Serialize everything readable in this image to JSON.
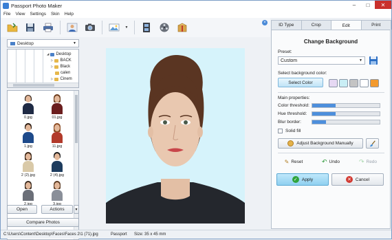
{
  "window": {
    "title": "Passport Photo Maker"
  },
  "menu": [
    "File",
    "View",
    "Settings",
    "Skin",
    "Help"
  ],
  "toolbar": {
    "icons": [
      "open-folder-icon",
      "save-icon",
      "print-icon",
      "user-template-icon",
      "camera-icon",
      "image-enhance-icon",
      "film-icon",
      "film-reel-icon",
      "package-icon"
    ]
  },
  "left": {
    "folder": "Desktop",
    "tree": [
      "Desktop",
      "BACK",
      "Black",
      "calen",
      "Cinem"
    ],
    "thumbnails": [
      "0.jpg",
      "01.jpg",
      "1.jpg",
      "11.jpg",
      "2 (2).jpg",
      "2 (4).jpg",
      "2.jpg",
      "3.jpg"
    ],
    "open_label": "Open",
    "actions_label": "Actions",
    "compare_label": "Compare Photos"
  },
  "tabs": [
    "ID Type",
    "Crop",
    "Edit",
    "Print"
  ],
  "active_tab": "Edit",
  "edit": {
    "title": "Change Background",
    "preset_label": "Preset:",
    "preset_value": "Custom",
    "bgcolor_label": "Select background color:",
    "select_color_label": "Select Color",
    "swatches": [
      "#e6d8f3",
      "#c9eef5",
      "#c4c4c4",
      "#ffffff",
      "#f39a2e"
    ],
    "main_props_label": "Main properties:",
    "properties": [
      {
        "label": "Color threshold:",
        "value": 0.35
      },
      {
        "label": "Hue threshold:",
        "value": 0.35
      },
      {
        "label": "Blur border:",
        "value": 0.2
      }
    ],
    "solid_fill_label": "Solid fill",
    "adjust_label": "Adjust Background Manually",
    "reset_label": "Reset",
    "undo_label": "Undo",
    "redo_label": "Redo",
    "apply_label": "Apply",
    "cancel_label": "Cancel"
  },
  "status": {
    "path": "C:\\Users\\Content\\Desktop\\Faces\\Faces 2\\1 (71).jpg",
    "type": "Passport",
    "size": "Size: 35 x 45 mm"
  },
  "colors": {
    "photo_background": "#d6f3fb",
    "accent": "#4d8fdc",
    "apply": "#8fd0f0"
  }
}
